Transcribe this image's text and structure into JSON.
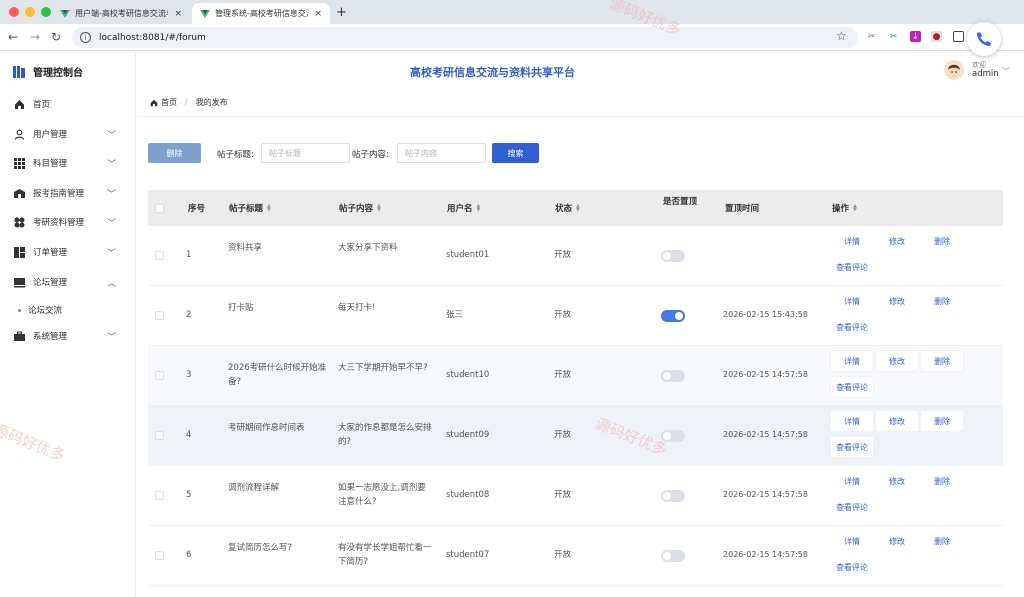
{
  "browser": {
    "tabs": [
      {
        "label": "用户端-高校考研信息交流与资料..."
      },
      {
        "label": "管理系统-高校考研信息交流与资..."
      }
    ],
    "url": "localhost:8081/#/forum",
    "new_tab": "+",
    "close": "×"
  },
  "sidebar": {
    "title": "管理控制台",
    "items": [
      {
        "label": "首页",
        "icon": "home-icon"
      },
      {
        "label": "用户管理",
        "icon": "user-icon"
      },
      {
        "label": "科目管理",
        "icon": "grid-icon"
      },
      {
        "label": "报考指南管理",
        "icon": "guide-icon"
      },
      {
        "label": "考研资料管理",
        "icon": "material-icon"
      },
      {
        "label": "订单管理",
        "icon": "order-icon"
      },
      {
        "label": "论坛管理",
        "icon": "forum-icon"
      },
      {
        "label": "系统管理",
        "icon": "system-icon"
      }
    ],
    "sub_items": [
      {
        "label": "论坛交流"
      }
    ]
  },
  "header": {
    "title": "高校考研信息交流与资料共享平台",
    "welcome": "欢迎",
    "username": "admin"
  },
  "breadcrumb": {
    "home": "首页",
    "sep": "/",
    "current": "我的发布"
  },
  "toolbar": {
    "delete_label": "删除",
    "title_label": "帖子标题:",
    "title_placeholder": "帖子标题",
    "content_label": "帖子内容:",
    "content_placeholder": "帖子内容",
    "search_label": "搜索"
  },
  "table": {
    "headers": {
      "index": "序号",
      "title": "帖子标题",
      "content": "帖子内容",
      "user": "用户名",
      "status": "状态",
      "pinned": "是否置顶",
      "pin_time": "置顶时间",
      "ops": "操作"
    },
    "actions": {
      "detail": "详情",
      "edit": "修改",
      "delete": "删除",
      "comments": "查看评论"
    },
    "rows": [
      {
        "index": "1",
        "title": "资料共享",
        "content": "大家分享下资料",
        "user": "student01",
        "status": "开放",
        "pinned": false,
        "pin_time": ""
      },
      {
        "index": "2",
        "title": "打卡贴",
        "content": "每天打卡!",
        "user": "张三",
        "status": "开放",
        "pinned": true,
        "pin_time": "2026-02-15 15:43:58"
      },
      {
        "index": "3",
        "title": "2026考研什么时候开始准备?",
        "content": "大三下学期开始早不早?",
        "user": "student10",
        "status": "开放",
        "pinned": false,
        "pin_time": "2026-02-15 14:57:58"
      },
      {
        "index": "4",
        "title": "考研期间作息时间表",
        "content": "大家的作息都是怎么安排的?",
        "user": "student09",
        "status": "开放",
        "pinned": false,
        "pin_time": "2026-02-15 14:57:58"
      },
      {
        "index": "5",
        "title": "调剂流程详解",
        "content": "如果一志愿没上,调剂要注意什么?",
        "user": "student08",
        "status": "开放",
        "pinned": false,
        "pin_time": "2026-02-15 14:57:58"
      },
      {
        "index": "6",
        "title": "复试简历怎么写?",
        "content": "有没有学长学姐帮忙看一下简历?",
        "user": "student07",
        "status": "开放",
        "pinned": false,
        "pin_time": "2026-02-15 14:57:58"
      }
    ]
  },
  "watermark": "源码好优多",
  "colors": {
    "primary": "#3160d4",
    "delete_btn": "#7ea1cd",
    "switch_on": "#3f7be6"
  }
}
